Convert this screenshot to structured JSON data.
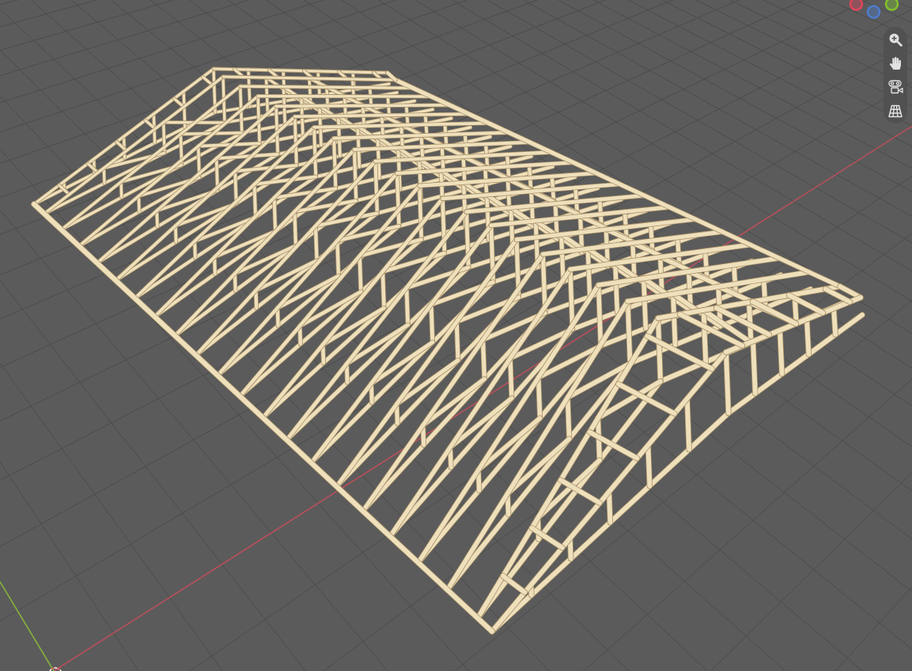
{
  "viewport": {
    "axis_gizmo": [
      {
        "color": "#e0455b"
      },
      {
        "color": "#4f7ccc"
      },
      {
        "color": "#80c22e"
      }
    ],
    "navigation_tools": [
      {
        "kind": "zoom"
      },
      {
        "kind": "pan"
      },
      {
        "kind": "camera"
      },
      {
        "kind": "grid"
      }
    ]
  }
}
